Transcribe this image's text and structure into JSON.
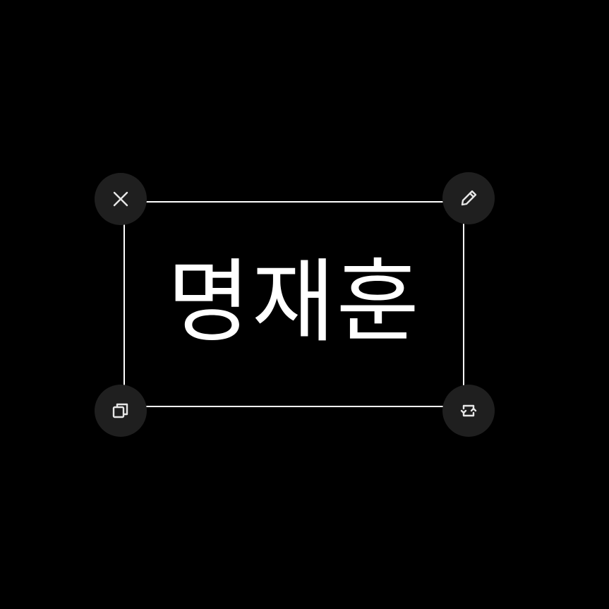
{
  "sticker": {
    "text": "명재훈"
  },
  "colors": {
    "background": "#000000",
    "frame": "#ffffff",
    "handle_fill": "#1f1f1f",
    "icon": "#e6e6e6"
  },
  "handles": {
    "delete": {
      "icon": "close-icon"
    },
    "edit": {
      "icon": "pencil-icon"
    },
    "duplicate": {
      "icon": "copy-icon"
    },
    "rotate": {
      "icon": "rotate-icon"
    }
  }
}
